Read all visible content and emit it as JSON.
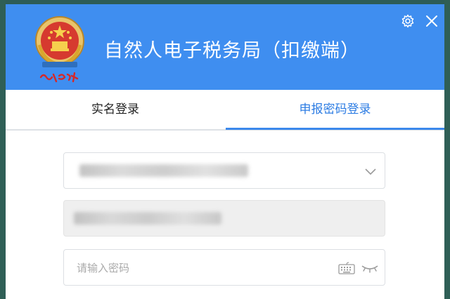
{
  "window": {
    "title": "自然人电子税务局（扣缴端）",
    "accent_color": "#3f8ef0"
  },
  "header": {
    "logo_icon": "national-tax-emblem-icon",
    "settings_icon": "gear-icon",
    "close_icon": "close-icon"
  },
  "tabs": [
    {
      "label": "实名登录",
      "active": false
    },
    {
      "label": "申报密码登录",
      "active": true
    }
  ],
  "form": {
    "account_field": {
      "value": "",
      "icon": "chevron-down-icon",
      "masked": true
    },
    "name_field": {
      "value": "",
      "readonly": true,
      "masked": true
    },
    "password_field": {
      "value": "",
      "placeholder": "请输入密码",
      "keyboard_icon": "keyboard-icon",
      "visibility_icon": "eye-closed-icon"
    }
  }
}
